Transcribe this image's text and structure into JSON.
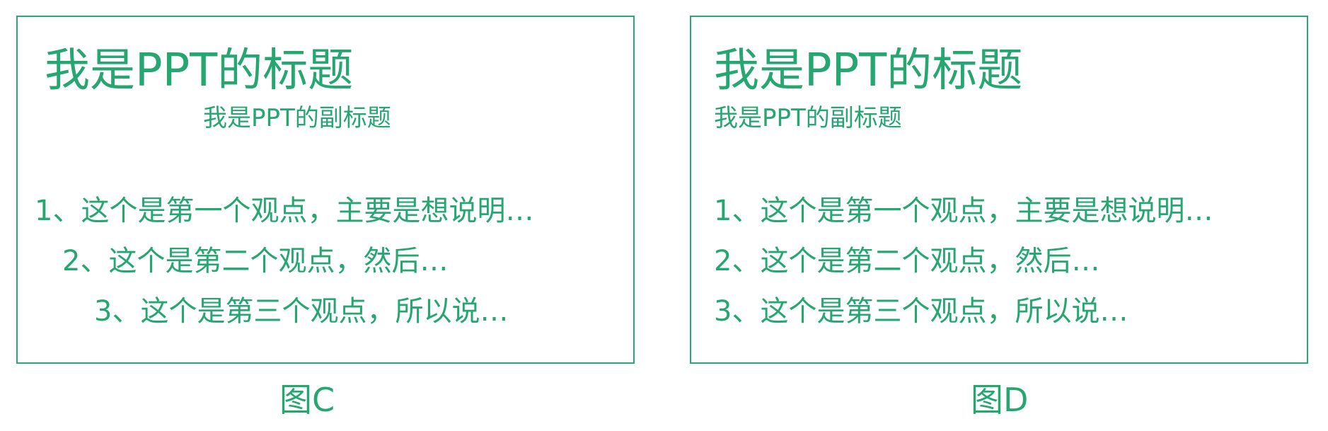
{
  "colors": {
    "accent": "#26a671",
    "border": "#2aa876",
    "background": "#ffffff"
  },
  "slide_c": {
    "title": "我是PPT的标题",
    "subtitle": "我是PPT的副标题",
    "points": [
      "1、这个是第一个观点，主要是想说明…",
      "2、这个是第二个观点，然后…",
      "3、这个是第三个观点，所以说…"
    ],
    "caption": "图C"
  },
  "slide_d": {
    "title": "我是PPT的标题",
    "subtitle": "我是PPT的副标题",
    "points": [
      "1、这个是第一个观点，主要是想说明…",
      "2、这个是第二个观点，然后…",
      "3、这个是第三个观点，所以说…"
    ],
    "caption": "图D"
  }
}
